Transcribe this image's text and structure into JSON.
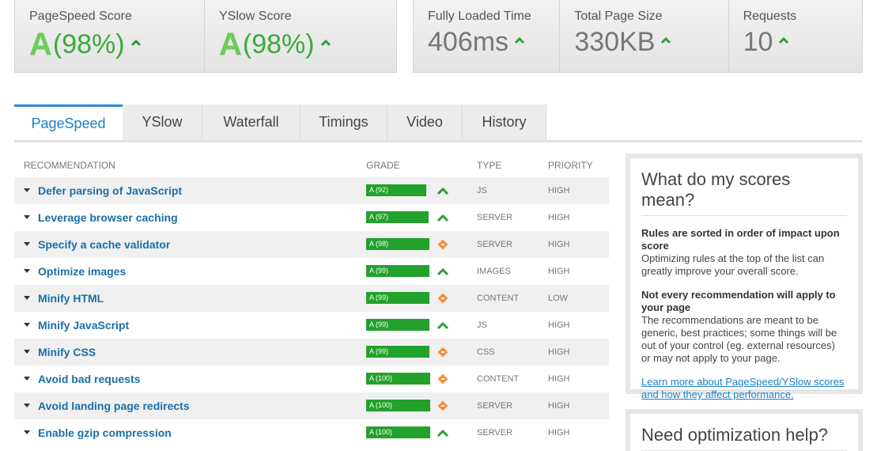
{
  "scores": {
    "pagespeed": {
      "label": "PageSpeed Score",
      "grade": "A",
      "percent": "(98%)"
    },
    "yslow": {
      "label": "YSlow Score",
      "grade": "A",
      "percent": "(98%)"
    }
  },
  "metrics": {
    "fully_loaded": {
      "label": "Fully Loaded Time",
      "value": "406ms"
    },
    "page_size": {
      "label": "Total Page Size",
      "value": "330KB"
    },
    "requests": {
      "label": "Requests",
      "value": "10"
    }
  },
  "tabs": [
    "PageSpeed",
    "YSlow",
    "Waterfall",
    "Timings",
    "Video",
    "History"
  ],
  "active_tab": "PageSpeed",
  "table": {
    "headers": {
      "recommendation": "RECOMMENDATION",
      "grade": "GRADE",
      "type": "TYPE",
      "priority": "PRIORITY"
    },
    "rows": [
      {
        "name": "Defer parsing of JavaScript",
        "grade": "A (92)",
        "score": 92,
        "trend": "up",
        "type": "JS",
        "priority": "HIGH"
      },
      {
        "name": "Leverage browser caching",
        "grade": "A (97)",
        "score": 97,
        "trend": "up",
        "type": "SERVER",
        "priority": "HIGH"
      },
      {
        "name": "Specify a cache validator",
        "grade": "A (98)",
        "score": 98,
        "trend": "same",
        "type": "SERVER",
        "priority": "HIGH"
      },
      {
        "name": "Optimize images",
        "grade": "A (99)",
        "score": 99,
        "trend": "up",
        "type": "IMAGES",
        "priority": "HIGH"
      },
      {
        "name": "Minify HTML",
        "grade": "A (99)",
        "score": 99,
        "trend": "same",
        "type": "CONTENT",
        "priority": "LOW"
      },
      {
        "name": "Minify JavaScript",
        "grade": "A (99)",
        "score": 99,
        "trend": "up",
        "type": "JS",
        "priority": "HIGH"
      },
      {
        "name": "Minify CSS",
        "grade": "A (99)",
        "score": 99,
        "trend": "same",
        "type": "CSS",
        "priority": "HIGH"
      },
      {
        "name": "Avoid bad requests",
        "grade": "A (100)",
        "score": 100,
        "trend": "same",
        "type": "CONTENT",
        "priority": "HIGH"
      },
      {
        "name": "Avoid landing page redirects",
        "grade": "A (100)",
        "score": 100,
        "trend": "same",
        "type": "SERVER",
        "priority": "HIGH"
      },
      {
        "name": "Enable gzip compression",
        "grade": "A (100)",
        "score": 100,
        "trend": "up",
        "type": "SERVER",
        "priority": "HIGH"
      }
    ]
  },
  "scores_info": {
    "title": "What do my scores mean?",
    "point1_title": "Rules are sorted in order of impact upon score",
    "point1_text": "Optimizing rules at the top of the list can greatly improve your overall score.",
    "point2_title": "Not every recommendation will apply to your page",
    "point2_text": "The recommendations are meant to be generic, best practices; some things will be out of your control (eg. external resources) or may not apply to your page.",
    "link": "Learn more about PageSpeed/YSlow scores and how they affect performance."
  },
  "help_box": {
    "title": "Need optimization help?"
  },
  "colors": {
    "grade_green": "#22a12c",
    "trend_up": "#2e9e3c",
    "trend_same": "#f0913a",
    "link_blue": "#1b7fc6"
  }
}
